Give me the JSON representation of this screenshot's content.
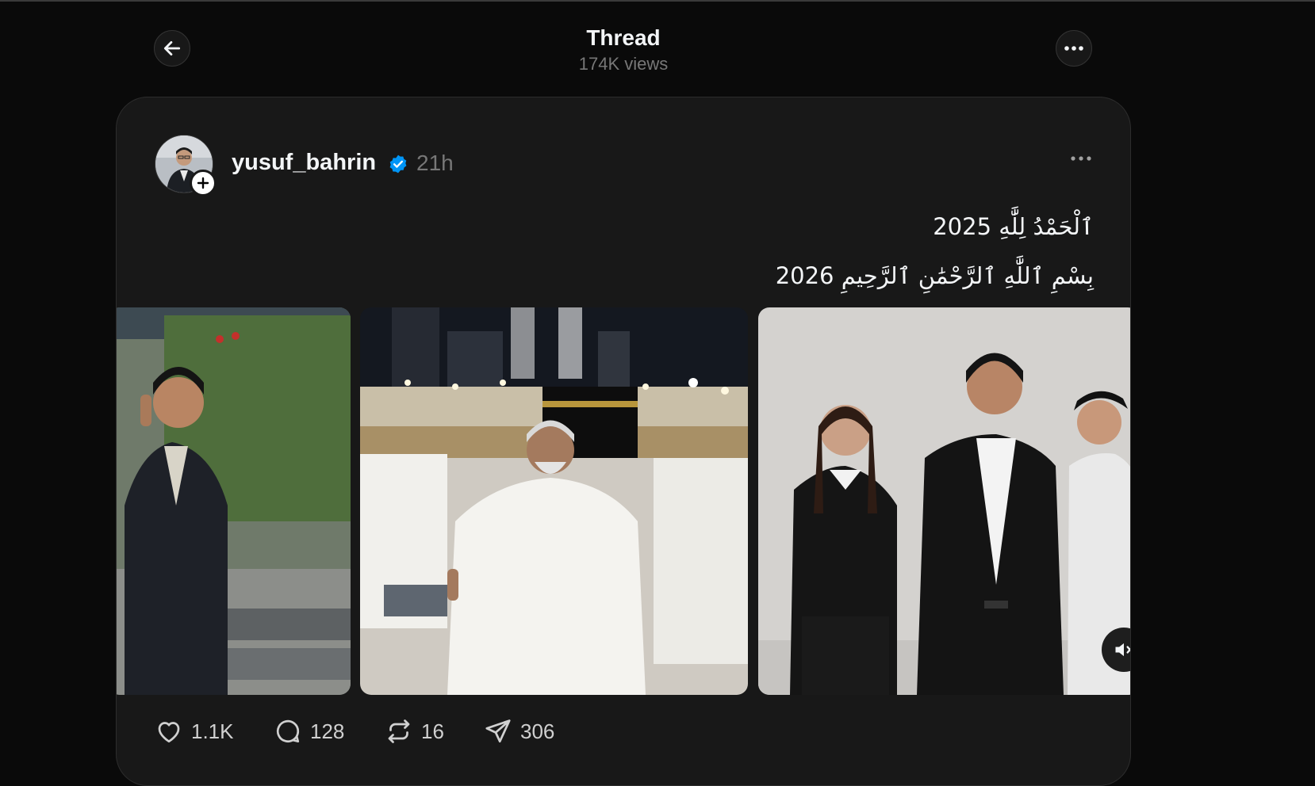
{
  "header": {
    "title": "Thread",
    "views": "174K views",
    "back_icon": "arrow-left-icon",
    "more_icon": "ellipsis-icon"
  },
  "post": {
    "username": "yusuf_bahrin",
    "verified": true,
    "time": "21h",
    "text_line1": "ٱلْحَمْدُ لِلَّٰهِ 2025",
    "text_line2": "بِسْمِ ٱللَّٰهِ ٱلرَّحْمَٰنِ ٱلرَّحِيمِ 2026",
    "media": [
      "photo",
      "photo",
      "video"
    ],
    "actions": {
      "likes": "1.1K",
      "replies": "128",
      "reposts": "16",
      "shares": "306"
    }
  },
  "colors": {
    "background": "#0a0a0a",
    "card": "#181818",
    "verified_blue": "#0095f6",
    "muted_text": "#777777"
  }
}
